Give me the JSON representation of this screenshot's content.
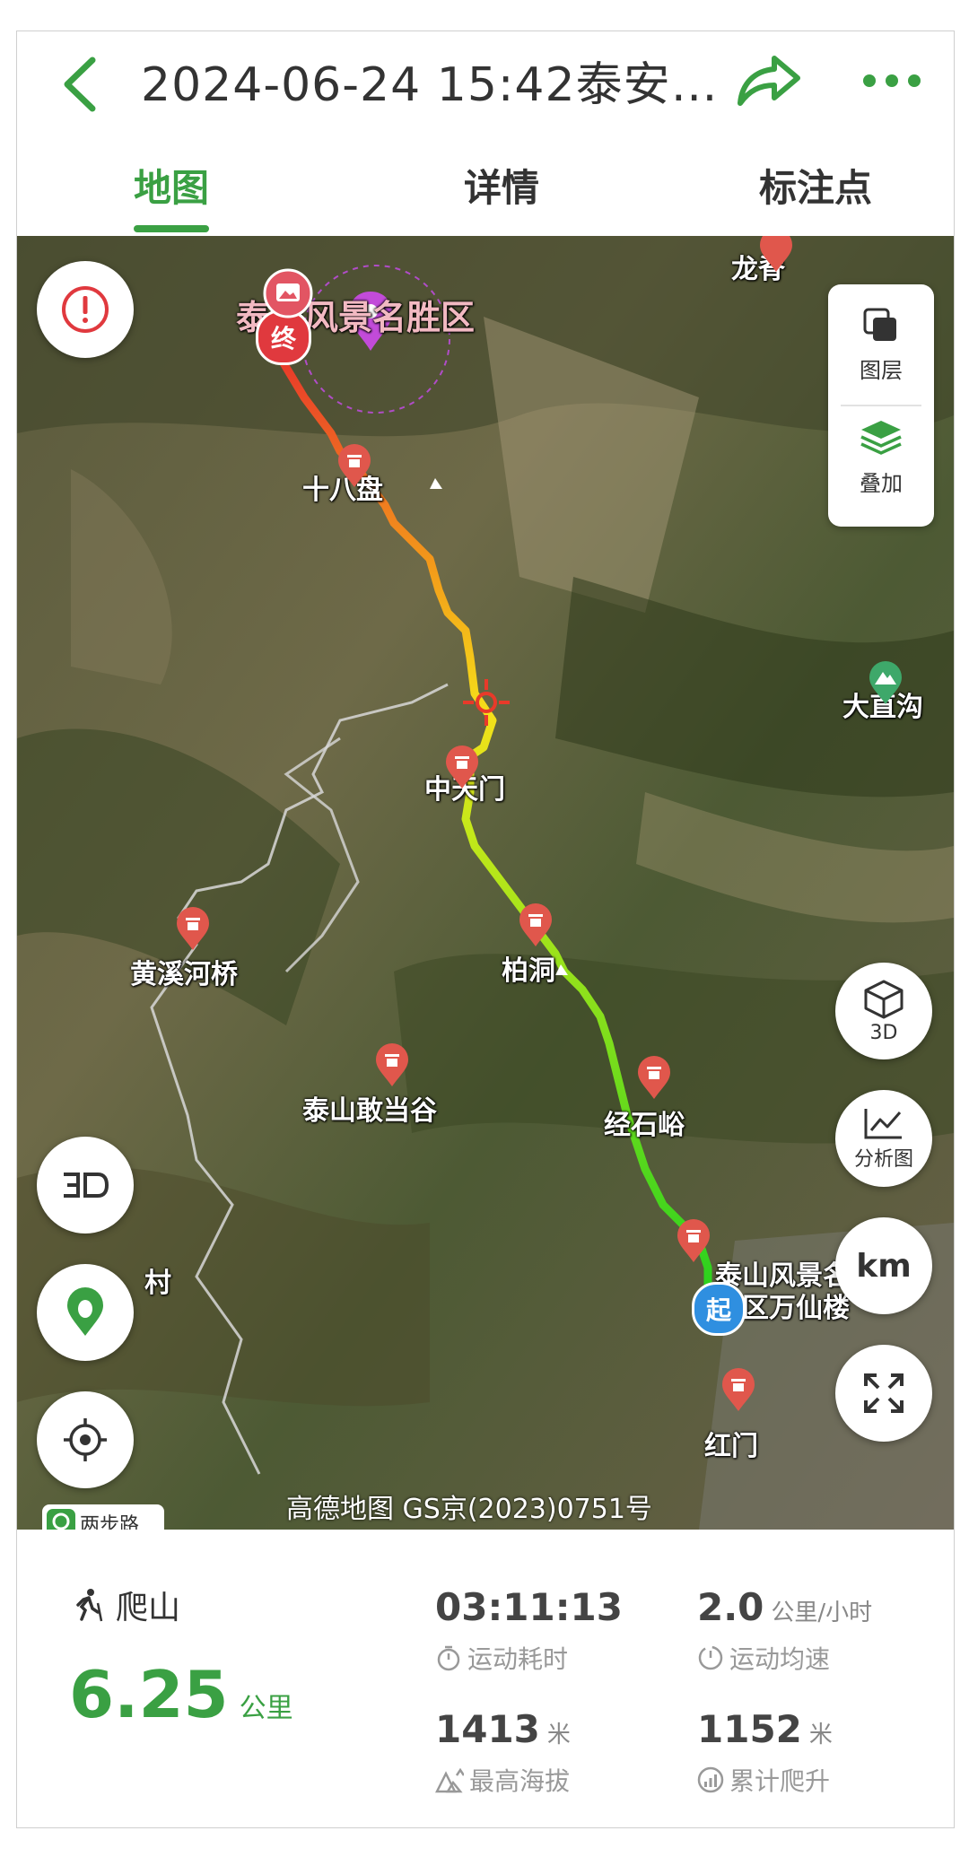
{
  "header": {
    "title": "2024-06-24 15:42泰安…",
    "tabs": [
      {
        "label": "地图",
        "active": true
      },
      {
        "label": "详情",
        "active": false
      },
      {
        "label": "标注点",
        "active": false
      }
    ]
  },
  "map": {
    "layers_label": "图层",
    "overlay_label": "叠加",
    "btn_3d_label": "3D",
    "btn_analysis_label": "分析图",
    "btn_km_label": "km",
    "start_marker": "起",
    "end_marker": "终",
    "copyright": "高德地图 GS京(2023)0751号",
    "liangbu_label": "两步路",
    "labels": {
      "longji": "龙脊",
      "scenic_top": "泰山风景名胜区",
      "shibapan": "十八盘",
      "dazhigou": "大直沟",
      "zhongtianmen": "中天门",
      "huangxihe": "黄溪河桥",
      "baidong": "柏洞",
      "gandanggu": "泰山敢当谷",
      "jingshiyu": "经石峪",
      "cun": "村",
      "wanxianlou": "泰山风景名\n胜区万仙楼",
      "hongmen": "红门"
    },
    "colors": {
      "accent": "#3aa043",
      "alert": "#e0393e",
      "start": "#2f8fe0"
    }
  },
  "stats": {
    "sport": "爬山",
    "distance": "6.25",
    "distance_unit": "公里",
    "duration": "03:11:13",
    "duration_label": "运动耗时",
    "speed": "2.0",
    "speed_unit": "公里/小时",
    "speed_label": "运动均速",
    "max_alt": "1413",
    "max_alt_unit": "米",
    "max_alt_label": "最高海拔",
    "ascent": "1152",
    "ascent_unit": "米",
    "ascent_label": "累计爬升"
  }
}
